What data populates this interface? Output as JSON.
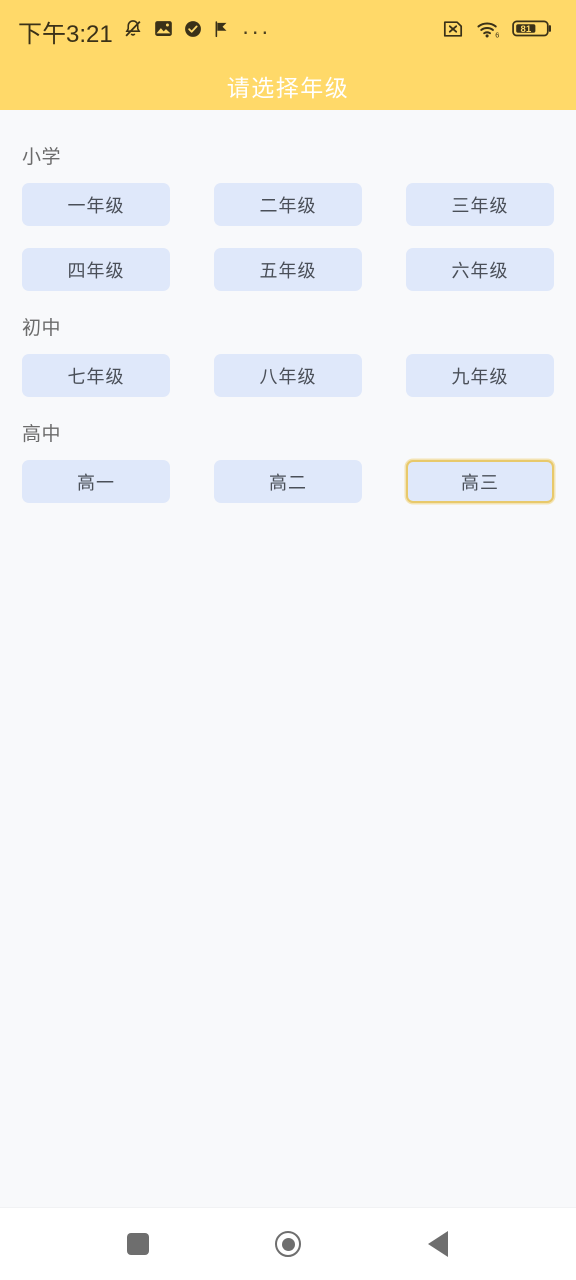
{
  "statusbar": {
    "clock": "下午3:21",
    "left_icons": [
      "bell-muted-icon",
      "image-download-icon",
      "check-circle-icon",
      "flag-icon",
      "more-dots-icon"
    ],
    "more_dots": "···",
    "right_icons": [
      "sim-off-icon",
      "wifi-6-icon",
      "battery-icon"
    ],
    "battery_level": "81",
    "wifi_label": "6",
    "background_color": "#ffd969"
  },
  "header": {
    "title": "请选择年级",
    "background_color": "#ffd969",
    "text_color": "#ffffff"
  },
  "content": {
    "background_color": "#f8f9fb",
    "button_color": "#dfe8fa",
    "selected_border_color": "#e8c96b",
    "sections": [
      {
        "label": "小学",
        "rows": [
          [
            {
              "label": "一年级",
              "selected": false
            },
            {
              "label": "二年级",
              "selected": false
            },
            {
              "label": "三年级",
              "selected": false
            }
          ],
          [
            {
              "label": "四年级",
              "selected": false
            },
            {
              "label": "五年级",
              "selected": false
            },
            {
              "label": "六年级",
              "selected": false
            }
          ]
        ]
      },
      {
        "label": "初中",
        "rows": [
          [
            {
              "label": "七年级",
              "selected": false
            },
            {
              "label": "八年级",
              "selected": false
            },
            {
              "label": "九年级",
              "selected": false
            }
          ]
        ]
      },
      {
        "label": "高中",
        "rows": [
          [
            {
              "label": "高一",
              "selected": false
            },
            {
              "label": "高二",
              "selected": false
            },
            {
              "label": "高三",
              "selected": true
            }
          ]
        ]
      }
    ]
  },
  "navbar": {
    "buttons": [
      {
        "name": "recents-button",
        "icon": "square-icon"
      },
      {
        "name": "home-button",
        "icon": "circle-icon"
      },
      {
        "name": "back-button",
        "icon": "triangle-left-icon"
      }
    ],
    "background_color": "#ffffff"
  }
}
